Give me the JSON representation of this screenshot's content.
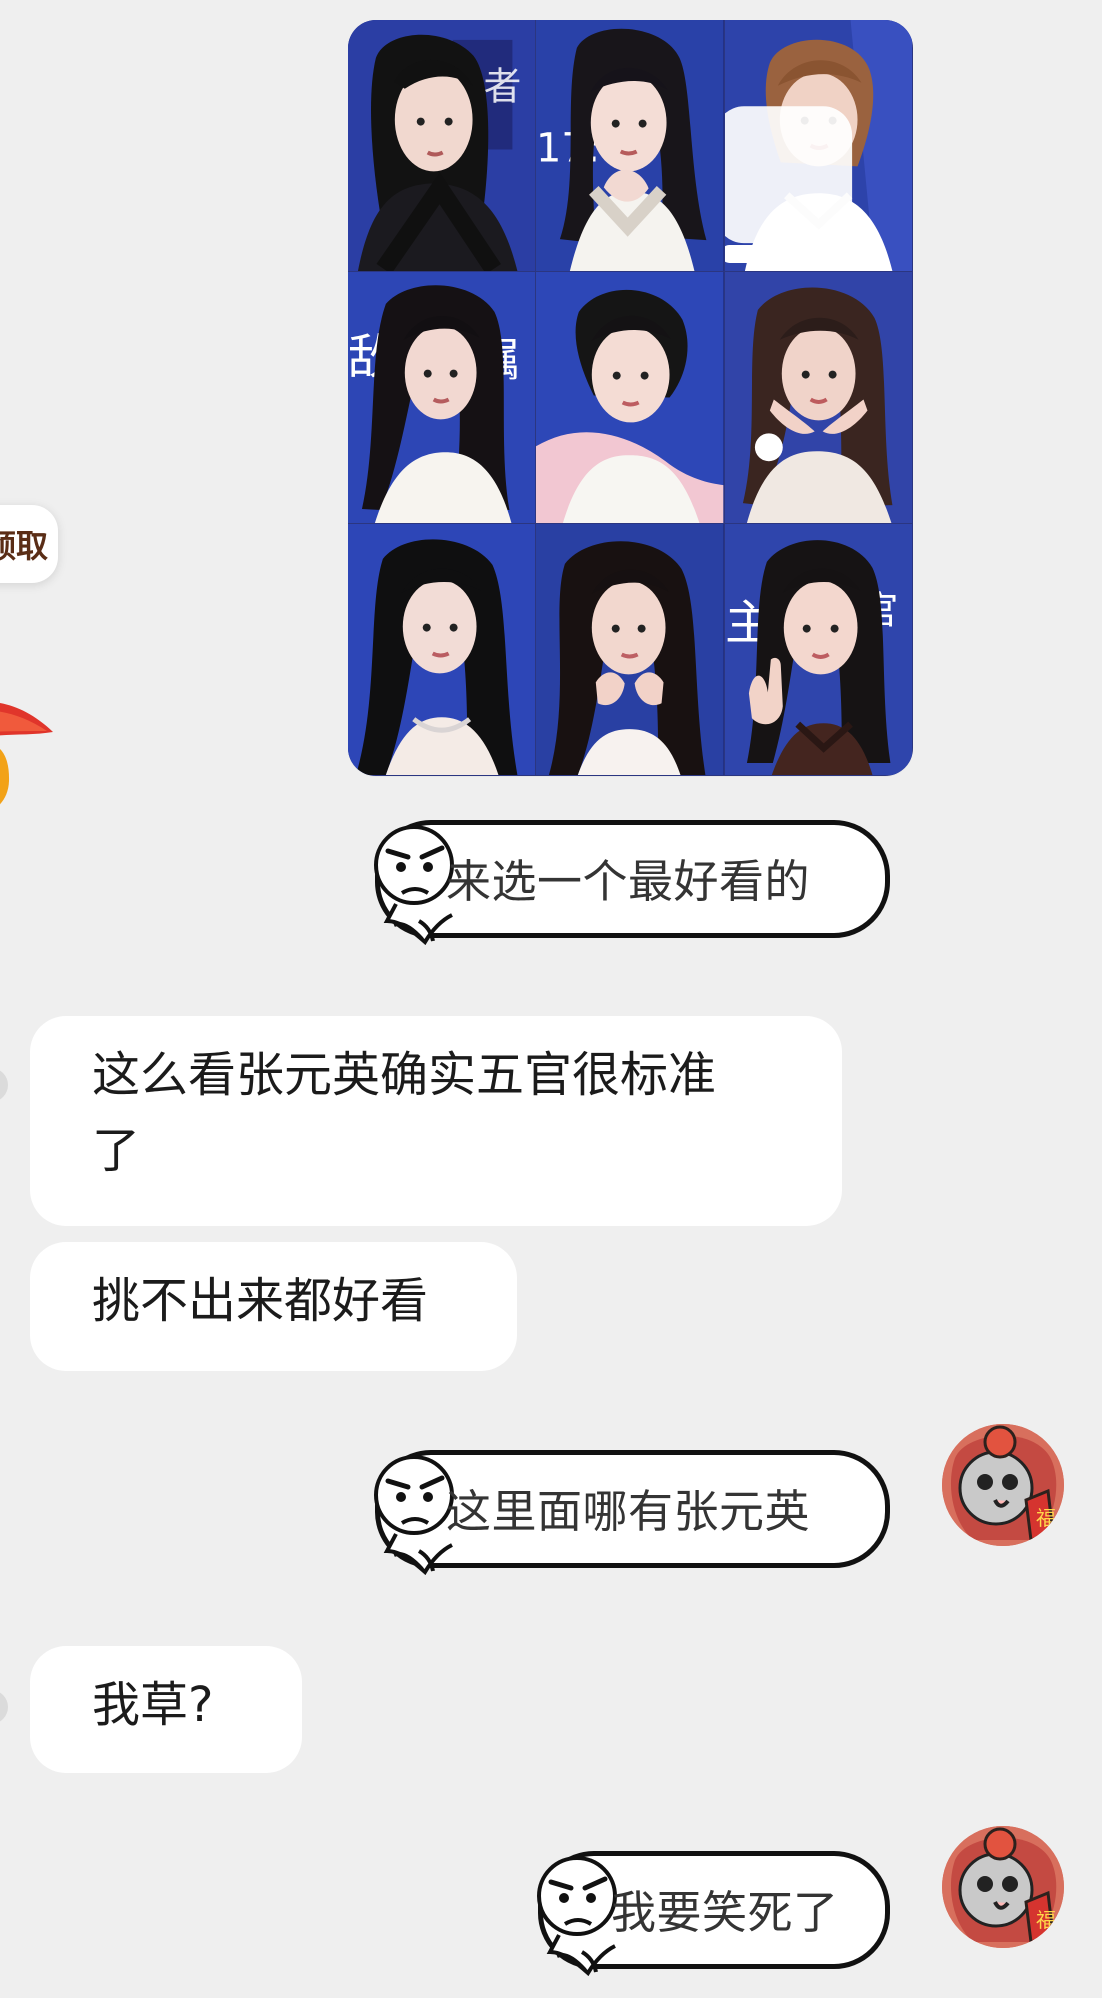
{
  "left_clipped": {
    "chip_label": "领取"
  },
  "image_message": {
    "photos": [
      {
        "name": "photo-1"
      },
      {
        "name": "photo-2"
      },
      {
        "name": "photo-3"
      },
      {
        "name": "photo-4"
      },
      {
        "name": "photo-5"
      },
      {
        "name": "photo-6"
      },
      {
        "name": "photo-7"
      },
      {
        "name": "photo-8"
      },
      {
        "name": "photo-9"
      }
    ],
    "icon": "multi-image-icon"
  },
  "messages": [
    {
      "type": "sticker",
      "sender": "me",
      "text": "来选一个最好看的"
    },
    {
      "type": "text",
      "sender": "other",
      "text": "这么看张元英确实五官很标准\n了"
    },
    {
      "type": "text",
      "sender": "other",
      "text": "挑不出来都好看"
    },
    {
      "type": "sticker",
      "sender": "me",
      "text": "这里面哪有张元英"
    },
    {
      "type": "text",
      "sender": "other",
      "text": "我草?"
    },
    {
      "type": "sticker",
      "sender": "me",
      "text": "我要笑死了"
    }
  ],
  "avatars": {
    "me_badge": "福"
  },
  "colors": {
    "background": "#efefef",
    "bubble": "#ffffff",
    "sticker_outline": "#111111",
    "grid_blue": "#253596",
    "avatar_red": "#d8725f"
  }
}
